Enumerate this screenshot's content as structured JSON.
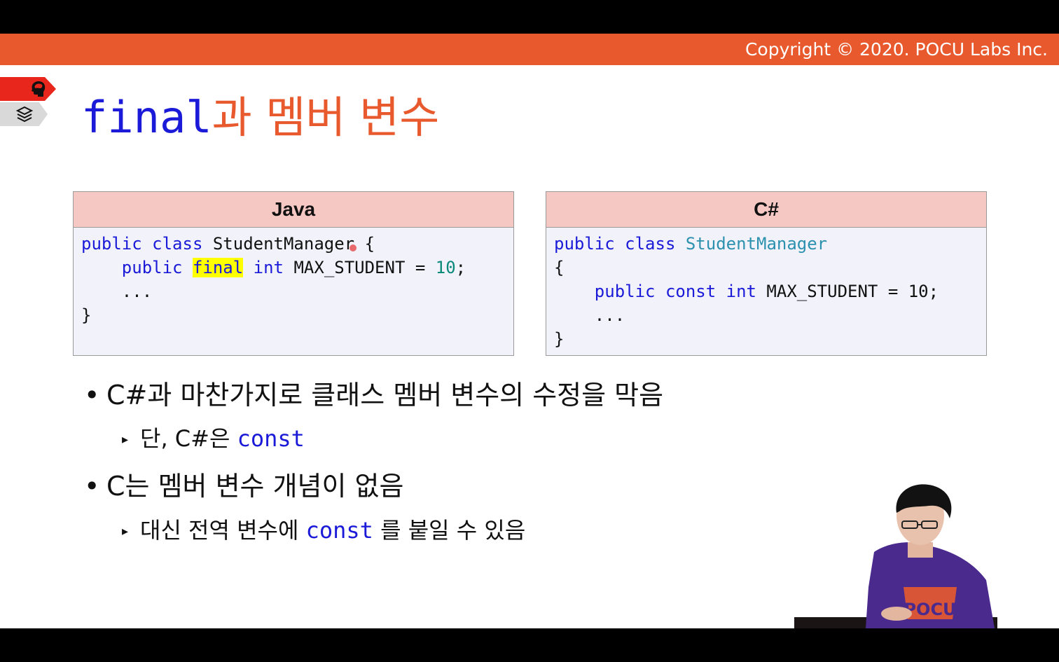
{
  "header": {
    "copyright": "Copyright © 2020. POCU Labs Inc."
  },
  "icons": {
    "brain": "brain-icon",
    "stack": "book-stack-icon"
  },
  "title": {
    "code_part": "final",
    "text_part": "과 멤버 변수"
  },
  "java_box": {
    "heading": "Java",
    "code": {
      "l1_kw": "public class",
      "l1_rest": " StudentManager {",
      "l2_indent": "    ",
      "l2_kw1": "public",
      "l2_final": "final",
      "l2_kw2": "int",
      "l2_name": " MAX_STUDENT = ",
      "l2_num": "10",
      "l2_end": ";",
      "l3": "    ...",
      "l4": "}"
    }
  },
  "csharp_box": {
    "heading": "C#",
    "code": {
      "l1_kw": "public class",
      "l1_type": "StudentManager",
      "l2": "{",
      "l3_indent": "    ",
      "l3_kw": "public const int",
      "l3_rest": " MAX_STUDENT = 10;",
      "l4": "    ...",
      "l5": "}"
    }
  },
  "bullets": {
    "b1": {
      "mark": "•",
      "text": "C#과 마찬가지로 클래스 멤버 변수의 수정을 막음"
    },
    "b1a": {
      "mark": "▸",
      "text": "단, C#은 ",
      "code": "const"
    },
    "b2": {
      "mark": "•",
      "text": "C는 멤버 변수 개념이 없음"
    },
    "b2a": {
      "mark": "▸",
      "text_before": "대신 전역 변수에 ",
      "code": "const",
      "text_after": " 를 붙일 수 있음"
    }
  },
  "presenter": {
    "shirt_text": "POCU"
  },
  "colors": {
    "accent": "#e85a2e",
    "keyword": "#1a1ad8",
    "number": "#0a8a7a",
    "type": "#2b91af",
    "highlight": "#ffff00"
  }
}
